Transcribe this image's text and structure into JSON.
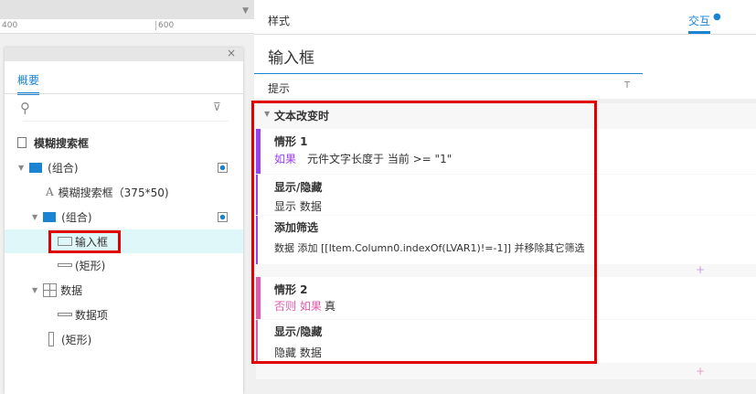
{
  "ruler": {
    "ticks": [
      "400",
      "600"
    ]
  },
  "outline": {
    "tab": "概要",
    "items": [
      {
        "label": "模糊搜索框",
        "icon": "page-icon"
      },
      {
        "label": "(组合)",
        "icon": "folder-icon"
      },
      {
        "label": "模糊搜索框（375*50)",
        "icon": "text-icon"
      },
      {
        "label": "(组合)",
        "icon": "folder-icon"
      },
      {
        "label": "输入框",
        "icon": "input-icon"
      },
      {
        "label": "(矩形)",
        "icon": "rectangle-icon"
      },
      {
        "label": "数据",
        "icon": "repeater-icon"
      },
      {
        "label": "数据项",
        "icon": "rectangle-icon"
      },
      {
        "label": "(矩形)",
        "icon": "vertical-rectangle-icon"
      }
    ]
  },
  "inspector": {
    "tabs": [
      "样式",
      "交互"
    ],
    "active_tab": "交互",
    "widget_name": "输入框",
    "hint_label": "提示",
    "hint_type": "T",
    "event": "文本改变时",
    "cases": [
      {
        "title": "情形 1",
        "cond_kw": "如果",
        "cond_rest": "元件文字长度于 当前 >= \"1\"",
        "color": "#9b3ef0",
        "actions": [
          {
            "name": "显示/隐藏",
            "detail": "显示 数据"
          },
          {
            "name": "添加筛选",
            "detail": "数据 添加 [[Item.Column0.indexOf(LVAR1)!=-1]] 并移除其它筛选"
          }
        ]
      },
      {
        "title": "情形 2",
        "cond_kw": "否则 如果",
        "cond_rest": "真",
        "color": "#e05aaa",
        "actions": [
          {
            "name": "显示/隐藏",
            "detail": "隐藏 数据"
          }
        ]
      }
    ],
    "add": "+"
  },
  "colors": {
    "accent": "#1a84d2",
    "highlight": "#e00000"
  }
}
